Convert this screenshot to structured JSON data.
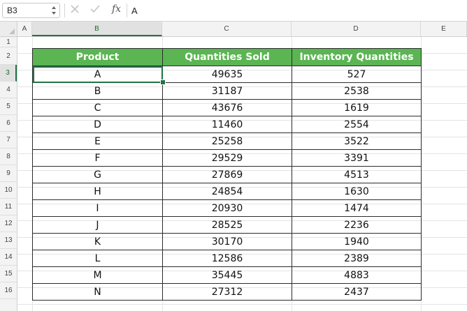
{
  "formula_bar": {
    "name_box": "B3",
    "fx_label": "fx",
    "content": "A"
  },
  "columns": [
    "A",
    "B",
    "C",
    "D",
    "E"
  ],
  "rows": [
    "1",
    "2",
    "3",
    "4",
    "5",
    "6",
    "7",
    "8",
    "9",
    "10",
    "11",
    "12",
    "13",
    "14",
    "15",
    "16"
  ],
  "table": {
    "headers": [
      "Product",
      "Quantities Sold",
      "Inventory Quantities"
    ],
    "rows": [
      [
        "A",
        "49635",
        "527"
      ],
      [
        "B",
        "31187",
        "2538"
      ],
      [
        "C",
        "43676",
        "1619"
      ],
      [
        "D",
        "11460",
        "2554"
      ],
      [
        "E",
        "25258",
        "3522"
      ],
      [
        "F",
        "29529",
        "3391"
      ],
      [
        "G",
        "27869",
        "4513"
      ],
      [
        "H",
        "24854",
        "1630"
      ],
      [
        "I",
        "20930",
        "1474"
      ],
      [
        "J",
        "28525",
        "2236"
      ],
      [
        "K",
        "30170",
        "1940"
      ],
      [
        "L",
        "12586",
        "2389"
      ],
      [
        "M",
        "35445",
        "4883"
      ],
      [
        "N",
        "27312",
        "2437"
      ]
    ],
    "header_color": "#5ab552"
  },
  "selection": {
    "cell": "B3",
    "accent": "#217346"
  }
}
